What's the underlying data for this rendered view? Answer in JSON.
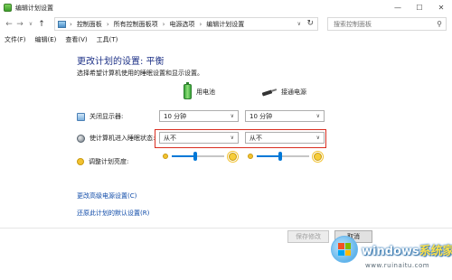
{
  "window": {
    "title": "编辑计划设置",
    "minimize": "—",
    "maximize": "☐",
    "close": "✕"
  },
  "nav": {
    "back": "←",
    "forward": "→",
    "dropdown": "∨",
    "up": "↑",
    "breadcrumbs": [
      "控制面板",
      "所有控制面板项",
      "电源选项",
      "编辑计划设置"
    ],
    "separator": "›",
    "search_placeholder": "搜索控制面板"
  },
  "menu": [
    "文件(F)",
    "编辑(E)",
    "查看(V)",
    "工具(T)"
  ],
  "page": {
    "title": "更改计划的设置: 平衡",
    "subtitle": "选择希望计算机使用的睡眠设置和显示设置。"
  },
  "columns": {
    "battery": "用电池",
    "plugged": "接通电源"
  },
  "settings": {
    "display_off": {
      "label": "关闭显示器:",
      "battery_value": "10 分钟",
      "plugged_value": "10 分钟"
    },
    "sleep": {
      "label": "使计算机进入睡眠状态:",
      "battery_value": "从不",
      "plugged_value": "从不"
    },
    "brightness": {
      "label": "调整计划亮度:",
      "battery_level": 0.45,
      "plugged_level": 0.45
    }
  },
  "links": {
    "advanced": "更改高级电源设置(C)",
    "restore": "还原此计划的默认设置(R)"
  },
  "buttons": {
    "save": "保存修改",
    "cancel": "取消"
  },
  "watermark": {
    "brand_main": "windows",
    "brand_accent": "系统家园",
    "url": "www.ruinaitu.com"
  },
  "colors": {
    "title_blue": "#1e3287",
    "link_blue": "#0e4aa8",
    "highlight_red": "#d92d20",
    "slider_blue": "#0078d7"
  }
}
